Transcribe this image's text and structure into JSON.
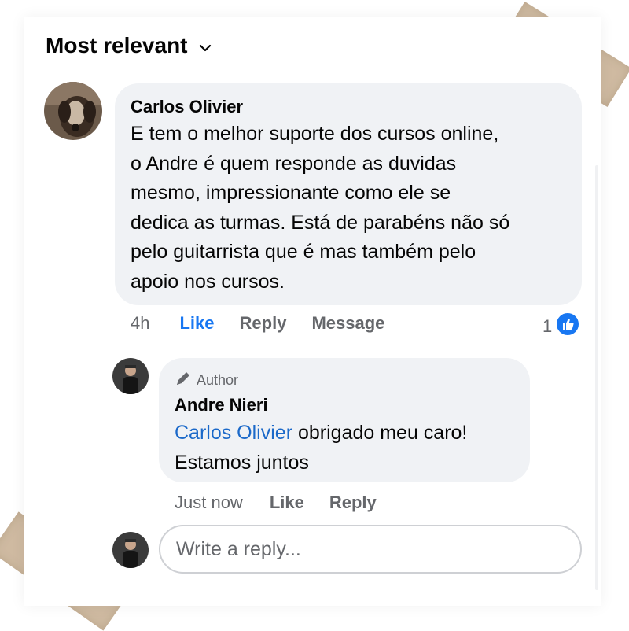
{
  "sort": {
    "label": "Most relevant"
  },
  "comment": {
    "author": "Carlos Olivier",
    "lines": [
      "E tem o melhor suporte dos cursos online,",
      "o Andre é quem responde as duvidas",
      "mesmo, impressionante como ele se",
      "dedica as turmas. Está de parabéns não só",
      "pelo guitarrista que é mas também pelo",
      "apoio nos cursos."
    ],
    "time": "4h",
    "like_label": "Like",
    "reply_label": "Reply",
    "message_label": "Message",
    "reaction_count": "1"
  },
  "reply": {
    "badge": "Author",
    "author": "Andre Nieri",
    "mention": "Carlos Olivier",
    "line1_rest": " obrigado meu caro!",
    "line2": "Estamos juntos",
    "time": "Just now",
    "like_label": "Like",
    "reply_label": "Reply"
  },
  "composer": {
    "placeholder": "Write a reply..."
  },
  "colors": {
    "like_blue": "#1877f2",
    "mention_blue": "#1b69c9",
    "bubble": "#f0f2f5",
    "tape": "#cbb59a"
  }
}
